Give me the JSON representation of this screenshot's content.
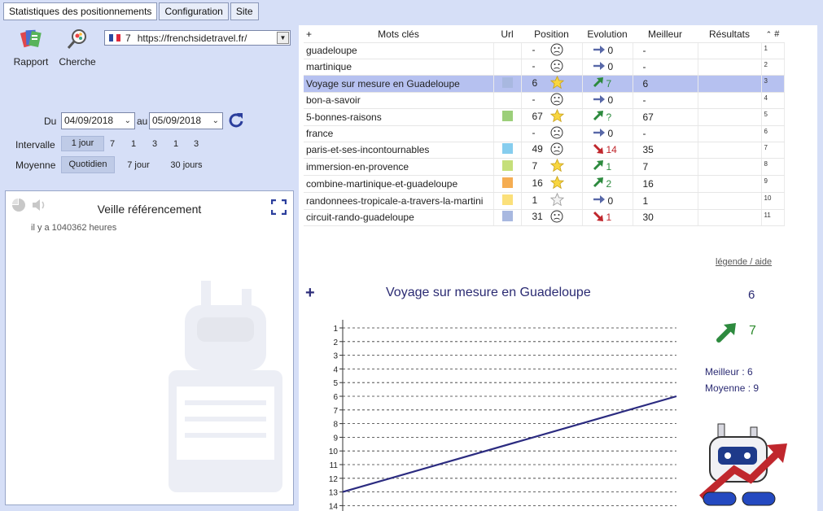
{
  "tabs": [
    {
      "label": "Statistiques des positionnements",
      "active": true
    },
    {
      "label": "Configuration",
      "active": false
    },
    {
      "label": "Site",
      "active": false
    }
  ],
  "toolbar": {
    "rapport": "Rapport",
    "cherche": "Cherche"
  },
  "site": {
    "count": "7",
    "url": "https://frenchsidetravel.fr/"
  },
  "filters": {
    "du_label": "Du",
    "du_value": "04/09/2018",
    "au_label": "au",
    "au_value": "05/09/2018",
    "intervalle_label": "Intervalle",
    "intervalle_options": [
      "1 jour",
      "7",
      "1",
      "3",
      "1",
      "3"
    ],
    "moyenne_label": "Moyenne",
    "moyenne_options": [
      "Quotidien",
      "7 jour",
      "30 jours"
    ]
  },
  "veille": {
    "title": "Veille référencement",
    "subtitle": "il y a 1040362 heures"
  },
  "table": {
    "headers": {
      "plus": "+",
      "keywords": "Mots clés",
      "url": "Url",
      "position": "Position",
      "evolution": "Evolution",
      "best": "Meilleur",
      "results": "Résultats",
      "num": "#"
    },
    "rows": [
      {
        "kw": "guadeloupe",
        "color": "",
        "pos": "-",
        "icon": "sad",
        "dir": "right",
        "evo": "0",
        "best": "-",
        "num": "1",
        "selected": false
      },
      {
        "kw": "martinique",
        "color": "",
        "pos": "-",
        "icon": "sad",
        "dir": "right",
        "evo": "0",
        "best": "-",
        "num": "2",
        "selected": false
      },
      {
        "kw": "Voyage sur mesure en Guadeloupe",
        "color": "#a8b8e0",
        "pos": "6",
        "icon": "star",
        "dir": "up",
        "evo": "7",
        "best": "6",
        "num": "3",
        "selected": true
      },
      {
        "kw": "bon-a-savoir",
        "color": "",
        "pos": "-",
        "icon": "sad",
        "dir": "right",
        "evo": "0",
        "best": "-",
        "num": "4",
        "selected": false
      },
      {
        "kw": "5-bonnes-raisons",
        "color": "#9ccf7a",
        "pos": "67",
        "icon": "star",
        "dir": "up",
        "evo": "?",
        "best": "67",
        "num": "5",
        "selected": false
      },
      {
        "kw": "france",
        "color": "",
        "pos": "-",
        "icon": "sad",
        "dir": "right",
        "evo": "0",
        "best": "-",
        "num": "6",
        "selected": false
      },
      {
        "kw": "paris-et-ses-incontournables",
        "color": "#86cdee",
        "pos": "49",
        "icon": "sad",
        "dir": "down",
        "evo": "14",
        "best": "35",
        "num": "7",
        "selected": false
      },
      {
        "kw": "immersion-en-provence",
        "color": "#c5df7a",
        "pos": "7",
        "icon": "star",
        "dir": "up",
        "evo": "1",
        "best": "7",
        "num": "8",
        "selected": false
      },
      {
        "kw": "combine-martinique-et-guadeloupe",
        "color": "#f5ad52",
        "pos": "16",
        "icon": "star",
        "dir": "up",
        "evo": "2",
        "best": "16",
        "num": "9",
        "selected": false
      },
      {
        "kw": "randonnees-tropicale-a-travers-la-martini",
        "color": "#fbe07a",
        "pos": "1",
        "icon": "star-empty",
        "dir": "right",
        "evo": "0",
        "best": "1",
        "num": "10",
        "selected": false
      },
      {
        "kw": "circuit-rando-guadeloupe",
        "color": "#a8b8e0",
        "pos": "31",
        "icon": "sad",
        "dir": "down",
        "evo": "1",
        "best": "30",
        "num": "11",
        "selected": false
      }
    ]
  },
  "detail": {
    "legend_link": "légende / aide",
    "plus": "+",
    "title": "Voyage sur mesure en Guadeloupe",
    "position": "6",
    "evolution": "7",
    "best": "Meilleur : 6",
    "average": "Moyenne : 9"
  },
  "chart_data": {
    "type": "line",
    "y_ticks": [
      "1",
      "2",
      "3",
      "4",
      "5",
      "6",
      "7",
      "8",
      "9",
      "10",
      "11",
      "12",
      "13",
      "14"
    ],
    "y_reversed": true,
    "grid": true,
    "series": [
      {
        "values": [
          13,
          6
        ],
        "color": "#2b2b80"
      }
    ]
  }
}
